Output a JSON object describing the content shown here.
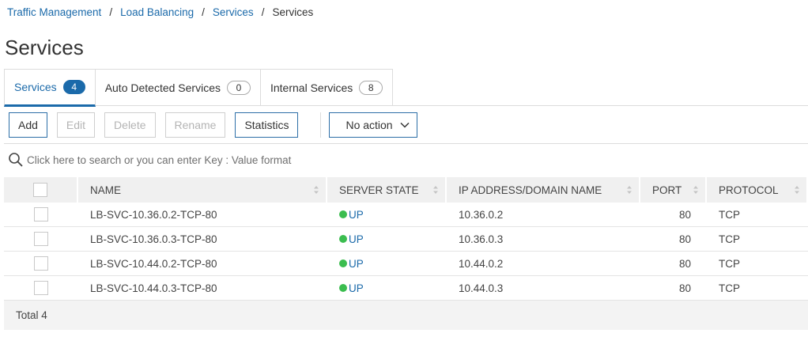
{
  "breadcrumb": {
    "items": [
      "Traffic Management",
      "Load Balancing",
      "Services"
    ],
    "current": "Services",
    "separator": "/"
  },
  "page": {
    "title": "Services"
  },
  "tabs": [
    {
      "label": "Services",
      "count": "4"
    },
    {
      "label": "Auto Detected Services",
      "count": "0"
    },
    {
      "label": "Internal Services",
      "count": "8"
    }
  ],
  "toolbar": {
    "add": "Add",
    "edit": "Edit",
    "delete": "Delete",
    "rename": "Rename",
    "statistics": "Statistics",
    "action_select": "No action"
  },
  "search": {
    "placeholder": "Click here to search or you can enter Key : Value format",
    "icon": "search-icon"
  },
  "table": {
    "columns": [
      "NAME",
      "SERVER STATE",
      "IP ADDRESS/DOMAIN NAME",
      "PORT",
      "PROTOCOL"
    ],
    "rows": [
      {
        "name": "LB-SVC-10.36.0.2-TCP-80",
        "state": "UP",
        "ip": "10.36.0.2",
        "port": "80",
        "protocol": "TCP"
      },
      {
        "name": "LB-SVC-10.36.0.3-TCP-80",
        "state": "UP",
        "ip": "10.36.0.3",
        "port": "80",
        "protocol": "TCP"
      },
      {
        "name": "LB-SVC-10.44.0.2-TCP-80",
        "state": "UP",
        "ip": "10.44.0.2",
        "port": "80",
        "protocol": "TCP"
      },
      {
        "name": "LB-SVC-10.44.0.3-TCP-80",
        "state": "UP",
        "ip": "10.44.0.3",
        "port": "80",
        "protocol": "TCP"
      }
    ]
  },
  "footer": {
    "total_label": "Total",
    "total_value": "4"
  },
  "colors": {
    "accent": "#1b6aaa",
    "status_up": "#3bbd4f"
  }
}
